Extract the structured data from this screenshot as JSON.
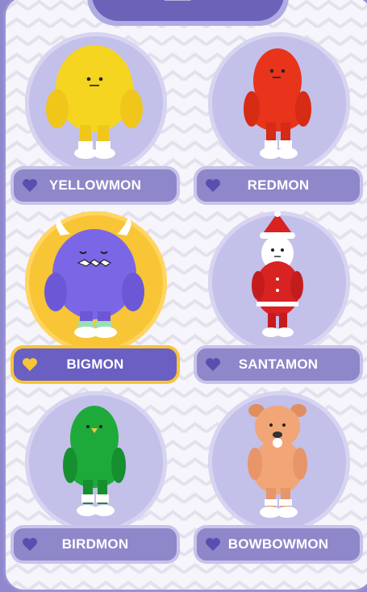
{
  "colors": {
    "accent": "#8e87c9",
    "selected": "#f7c536",
    "circle": "#c3c0e9"
  },
  "items": [
    {
      "name": "YELLOWMON",
      "color": "#f5d51f",
      "selected": false,
      "icon": "heart-icon"
    },
    {
      "name": "REDMON",
      "color": "#e8341b",
      "selected": false,
      "icon": "heart-icon"
    },
    {
      "name": "BIGMON",
      "color": "#7b67e6",
      "selected": true,
      "icon": "heart-icon"
    },
    {
      "name": "SANTAMON",
      "color": "#d92222",
      "selected": false,
      "icon": "heart-icon"
    },
    {
      "name": "BIRDMON",
      "color": "#1eaa3a",
      "selected": false,
      "icon": "heart-icon"
    },
    {
      "name": "BOWBOWMON",
      "color": "#f2a577",
      "selected": false,
      "icon": "heart-icon"
    }
  ]
}
